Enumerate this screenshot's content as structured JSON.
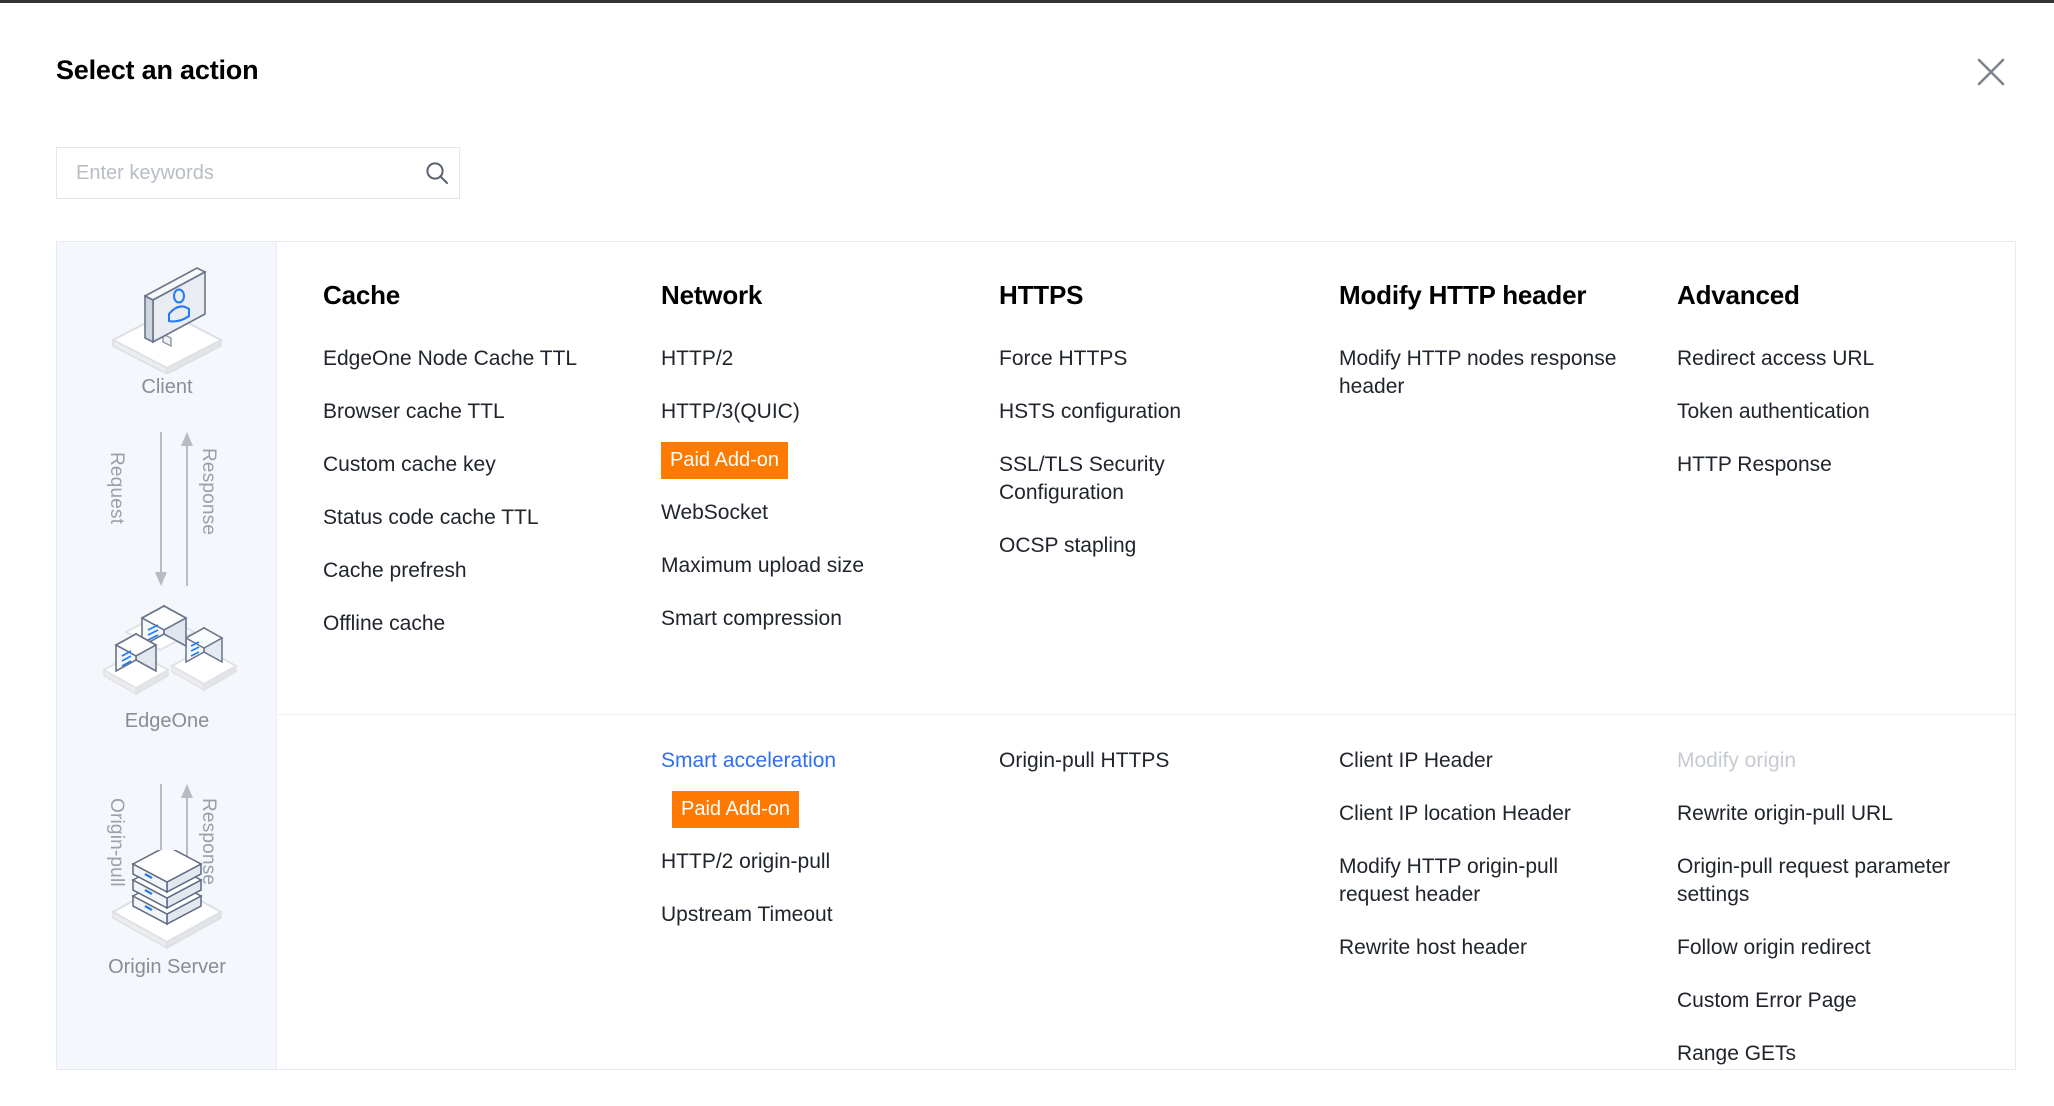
{
  "modal": {
    "title": "Select an action",
    "close_icon": "close-icon"
  },
  "search": {
    "placeholder": "Enter keywords",
    "value": "",
    "icon": "search-icon"
  },
  "diagram": {
    "nodes": [
      {
        "id": "client",
        "label": "Client",
        "icon": "client-monitor-icon"
      },
      {
        "id": "edgeone",
        "label": "EdgeOne",
        "icon": "edgeone-servers-icon"
      },
      {
        "id": "origin",
        "label": "Origin Server",
        "icon": "origin-server-stack-icon"
      }
    ],
    "flows": [
      {
        "id": "upper",
        "down_label": "Request",
        "up_label": "Response"
      },
      {
        "id": "lower",
        "down_label": "Origin-pull",
        "up_label": "Response"
      }
    ]
  },
  "badges": {
    "paid_addon": "Paid Add-on"
  },
  "colors": {
    "badge_orange": "#ff7a00",
    "link_blue": "#2f6ef2",
    "disabled_gray": "#c6cad1",
    "sidebar_bg": "#f4f7fb"
  },
  "columns": {
    "cache": "Cache",
    "network": "Network",
    "https": "HTTPS",
    "modify_http_header": "Modify HTTP header",
    "advanced": "Advanced"
  },
  "row_top": {
    "cache": [
      "EdgeOne Node Cache TTL",
      "Browser cache TTL",
      "Custom cache key",
      "Status code cache TTL",
      "Cache prefresh",
      "Offline cache"
    ],
    "network": {
      "http2": "HTTP/2",
      "http3": "HTTP/3(QUIC)",
      "websocket": "WebSocket",
      "max_upload": "Maximum upload size",
      "smart_compression": "Smart compression"
    },
    "https": [
      "Force HTTPS",
      "HSTS configuration",
      "SSL/TLS Security Configuration",
      "OCSP stapling"
    ],
    "modify_http_header": [
      "Modify HTTP nodes response header"
    ],
    "advanced": [
      "Redirect access URL",
      "Token authentication",
      "HTTP Response"
    ]
  },
  "row_bottom": {
    "network": {
      "smart_acceleration": "Smart acceleration",
      "http2_origin_pull": "HTTP/2 origin-pull",
      "upstream_timeout": "Upstream Timeout"
    },
    "https": [
      "Origin-pull HTTPS"
    ],
    "modify_http_header": [
      "Client IP Header",
      "Client IP location Header",
      "Modify HTTP origin-pull request header",
      "Rewrite host header"
    ],
    "advanced": {
      "modify_origin": "Modify origin",
      "items": [
        "Rewrite origin-pull URL",
        "Origin-pull request parameter settings",
        "Follow origin redirect",
        "Custom Error Page",
        "Range GETs"
      ]
    }
  }
}
